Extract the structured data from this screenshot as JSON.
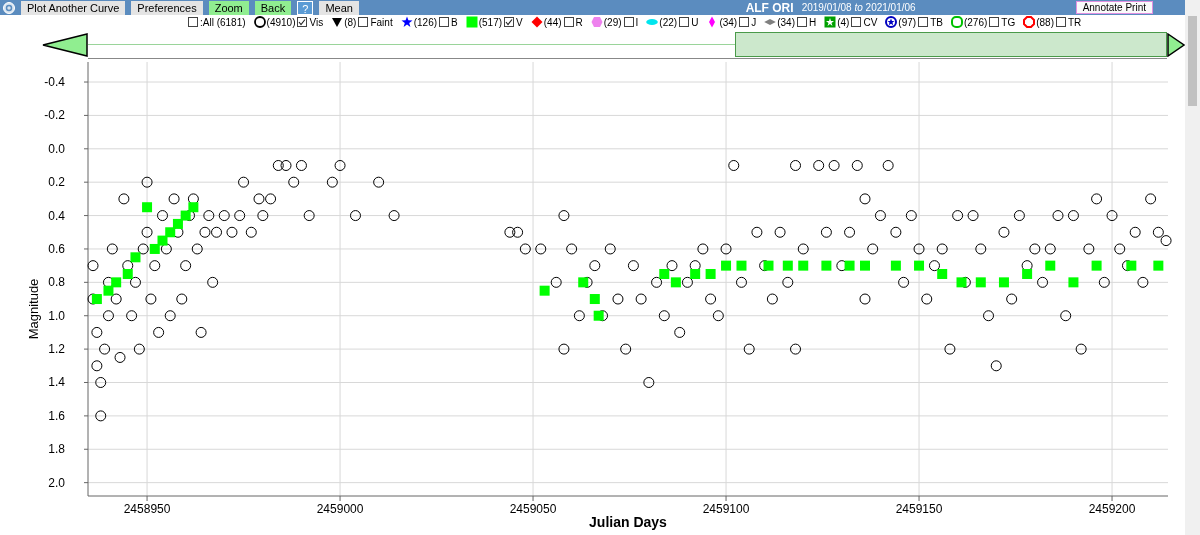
{
  "toolbar": {
    "buttons": [
      {
        "label": "Plot Another Curve",
        "kind": "normal"
      },
      {
        "label": "Preferences",
        "kind": "normal"
      },
      {
        "label": "Zoom",
        "kind": "active"
      },
      {
        "label": "Back",
        "kind": "active"
      },
      {
        "label": "?",
        "kind": "help"
      },
      {
        "label": "Mean",
        "kind": "normal"
      }
    ],
    "star_name": "ALF ORI",
    "date_range": "2019/01/08 *to* 2021/01/06",
    "annotate_button": "Annotate Print"
  },
  "legend": {
    "all_toggle": {
      "label": ":All (6181)",
      "checked": false
    },
    "bands": [
      {
        "kind": "circle",
        "color": "#000000",
        "count": "(4910)",
        "label": "Vis",
        "checked": true
      },
      {
        "kind": "triangle",
        "color": "#000000",
        "count": "(8)",
        "label": "Faint",
        "checked": false
      },
      {
        "kind": "star",
        "color": "#0000ff",
        "count": "(126)",
        "label": "B",
        "checked": false
      },
      {
        "kind": "square",
        "color": "#00ff00",
        "count": "(517)",
        "label": "V",
        "checked": true
      },
      {
        "kind": "diamond",
        "color": "#ff0000",
        "count": "(44)",
        "label": "R",
        "checked": false
      },
      {
        "kind": "hexagon",
        "color": "#ee82ee",
        "count": "(29)",
        "label": "I",
        "checked": false
      },
      {
        "kind": "ellipse",
        "color": "#00e5ee",
        "count": "(22)",
        "label": "U",
        "checked": false
      },
      {
        "kind": "slim",
        "color": "#ff00ff",
        "count": "(34)",
        "label": "J",
        "checked": false
      },
      {
        "kind": "flat",
        "color": "#808080",
        "count": "(34)",
        "label": "H",
        "checked": false
      },
      {
        "kind": "starsquare",
        "color": "#00a000",
        "count": "(4)",
        "label": "CV",
        "checked": false
      },
      {
        "kind": "starcircle",
        "color": "#0000c0",
        "count": "(97)",
        "label": "TB",
        "checked": false
      },
      {
        "kind": "ring",
        "color": "#00c000",
        "count": "(276)",
        "label": "TG",
        "checked": false
      },
      {
        "kind": "octagon",
        "color": "#ff0000",
        "count": "(88)",
        "label": "TR",
        "checked": false
      }
    ]
  },
  "range_slider": {
    "level": 0.4
  },
  "chart_data": {
    "type": "scatter",
    "xlabel": "Julian Days",
    "ylabel": "Magnitude",
    "xlim": [
      2458934.7,
      2459214.5
    ],
    "ylim": [
      2.08,
      -0.52
    ],
    "grid": true,
    "xticks": [
      {
        "value": 2458950,
        "label": "2458950"
      },
      {
        "value": 2459000,
        "label": "2459000"
      },
      {
        "value": 2459050,
        "label": "2459050"
      },
      {
        "value": 2459100,
        "label": "2459100"
      },
      {
        "value": 2459150,
        "label": "2459150"
      },
      {
        "value": 2459200,
        "label": "2459200"
      }
    ],
    "yticks": [
      {
        "value": -0.4,
        "label": "-0.4"
      },
      {
        "value": -0.2,
        "label": "-0.2"
      },
      {
        "value": 0,
        "label": "0.0"
      },
      {
        "value": 0.2,
        "label": "0.2"
      },
      {
        "value": 0.4,
        "label": "0.4"
      },
      {
        "value": 0.6,
        "label": "0.6"
      },
      {
        "value": 0.8,
        "label": "0.8"
      },
      {
        "value": 1.0,
        "label": "1.0"
      },
      {
        "value": 1.2,
        "label": "1.2"
      },
      {
        "value": 1.4,
        "label": "1.4"
      },
      {
        "value": 1.6,
        "label": "1.6"
      },
      {
        "value": 1.8,
        "label": "1.8"
      },
      {
        "value": 2.0,
        "label": "2.0"
      }
    ],
    "series": [
      {
        "color": "#000000",
        "x": [
          2458936,
          2458936,
          2458937,
          2458937,
          2458938,
          2458938,
          2458939,
          2458940,
          2458940,
          2458941,
          2458942,
          2458943,
          2458944,
          2458945,
          2458946,
          2458947,
          2458948,
          2458949,
          2458950,
          2458950,
          2458951,
          2458952,
          2458953,
          2458954,
          2458955,
          2458956,
          2458957,
          2458958,
          2458959,
          2458960,
          2458961,
          2458962,
          2458963,
          2458964,
          2458965,
          2458966,
          2458967,
          2458968,
          2458970,
          2458972,
          2458974,
          2458975,
          2458977,
          2458979,
          2458980,
          2458982,
          2458984,
          2458986,
          2458988,
          2458990,
          2458992,
          2458998,
          2459000,
          2459004,
          2459010,
          2459014,
          2459044,
          2459046,
          2459048,
          2459052,
          2459056,
          2459058,
          2459058,
          2459060,
          2459062,
          2459064,
          2459066,
          2459068,
          2459070,
          2459072,
          2459074,
          2459076,
          2459078,
          2459080,
          2459082,
          2459084,
          2459086,
          2459088,
          2459090,
          2459092,
          2459094,
          2459096,
          2459098,
          2459100,
          2459102,
          2459104,
          2459106,
          2459108,
          2459110,
          2459112,
          2459114,
          2459116,
          2459118,
          2459118,
          2459120,
          2459124,
          2459126,
          2459128,
          2459130,
          2459132,
          2459134,
          2459136,
          2459136,
          2459138,
          2459140,
          2459142,
          2459144,
          2459146,
          2459148,
          2459150,
          2459152,
          2459154,
          2459156,
          2459158,
          2459160,
          2459162,
          2459164,
          2459166,
          2459168,
          2459170,
          2459172,
          2459174,
          2459176,
          2459178,
          2459180,
          2459182,
          2459184,
          2459186,
          2459188,
          2459190,
          2459192,
          2459194,
          2459196,
          2459198,
          2459200,
          2459202,
          2459204,
          2459206,
          2459208,
          2459210,
          2459212,
          2459214
        ],
        "values": [
          0.7,
          0.9,
          1.1,
          1.3,
          1.6,
          1.4,
          1.2,
          0.8,
          1.0,
          0.6,
          0.9,
          1.25,
          0.3,
          0.7,
          1.0,
          0.8,
          1.2,
          0.6,
          0.2,
          0.5,
          0.9,
          0.7,
          1.1,
          0.4,
          0.6,
          1.0,
          0.3,
          0.5,
          0.9,
          0.7,
          0.4,
          0.3,
          0.6,
          1.1,
          0.5,
          0.4,
          0.8,
          0.5,
          0.4,
          0.5,
          0.4,
          0.2,
          0.5,
          0.3,
          0.4,
          0.3,
          0.1,
          0.1,
          0.2,
          0.1,
          0.4,
          0.2,
          0.1,
          0.4,
          0.2,
          0.4,
          0.5,
          0.5,
          0.6,
          0.6,
          0.8,
          0.4,
          1.2,
          0.6,
          1.0,
          0.8,
          0.7,
          1.0,
          0.6,
          0.9,
          1.2,
          0.7,
          0.9,
          1.4,
          0.8,
          1.0,
          0.7,
          1.1,
          0.8,
          0.7,
          0.6,
          0.9,
          1.0,
          0.6,
          0.1,
          0.8,
          1.2,
          0.5,
          0.7,
          0.9,
          0.5,
          0.8,
          0.1,
          1.2,
          0.6,
          0.1,
          0.5,
          0.1,
          0.7,
          0.5,
          0.1,
          0.3,
          0.9,
          0.6,
          0.4,
          0.1,
          0.5,
          0.8,
          0.4,
          0.6,
          0.9,
          0.7,
          0.6,
          1.2,
          0.4,
          0.8,
          0.4,
          0.6,
          1.0,
          1.3,
          0.5,
          0.9,
          0.4,
          0.7,
          0.6,
          0.8,
          0.6,
          0.4,
          1.0,
          0.4,
          1.2,
          0.6,
          0.3,
          0.8,
          0.4,
          0.6,
          0.7,
          0.5,
          0.8,
          0.3,
          0.5,
          0.55
        ]
      },
      {
        "color": "#00ff00",
        "x": [
          2458937,
          2458940,
          2458942,
          2458945,
          2458947,
          2458950,
          2458952,
          2458954,
          2458956,
          2458958,
          2458960,
          2458962,
          2459053,
          2459063,
          2459066,
          2459067,
          2459084,
          2459087,
          2459092,
          2459096,
          2459100,
          2459104,
          2459111,
          2459116,
          2459120,
          2459126,
          2459132,
          2459136,
          2459144,
          2459150,
          2459156,
          2459161,
          2459166,
          2459172,
          2459178,
          2459184,
          2459190,
          2459196,
          2459205,
          2459212
        ],
        "values": [
          0.9,
          0.85,
          0.8,
          0.75,
          0.65,
          0.35,
          0.6,
          0.55,
          0.5,
          0.45,
          0.4,
          0.35,
          0.85,
          0.8,
          0.9,
          1.0,
          0.75,
          0.8,
          0.75,
          0.75,
          0.7,
          0.7,
          0.7,
          0.7,
          0.7,
          0.7,
          0.7,
          0.7,
          0.7,
          0.7,
          0.75,
          0.8,
          0.8,
          0.8,
          0.75,
          0.7,
          0.8,
          0.7,
          0.7,
          0.7
        ]
      }
    ]
  }
}
